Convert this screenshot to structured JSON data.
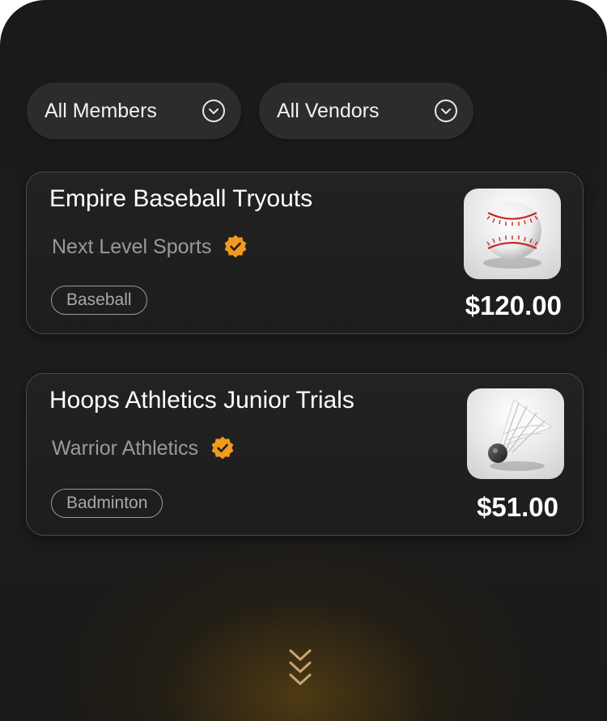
{
  "filters": [
    {
      "label": "All Members",
      "icon": "chevron-down-icon"
    },
    {
      "label": "All Vendors",
      "icon": "chevron-down-icon"
    }
  ],
  "events": [
    {
      "title": "Empire Baseball Tryouts",
      "vendor": "Next Level Sports",
      "verified_icon": "verified-badge-icon",
      "tag": "Baseball",
      "image": "baseball-image",
      "price": "$120.00"
    },
    {
      "title": "Hoops Athletics Junior Trials",
      "vendor": "Warrior Athletics",
      "verified_icon": "verified-badge-icon",
      "tag": "Badminton",
      "image": "shuttlecock-image",
      "price": "$51.00"
    }
  ],
  "scroll_indicator": {
    "icon": "triple-chevron-down-icon"
  },
  "colors": {
    "background": "#1b1b1b",
    "card": "#212121",
    "accent": "#f29a1f",
    "muted_text": "#9a9a9a",
    "glow": "#6e4d10"
  }
}
